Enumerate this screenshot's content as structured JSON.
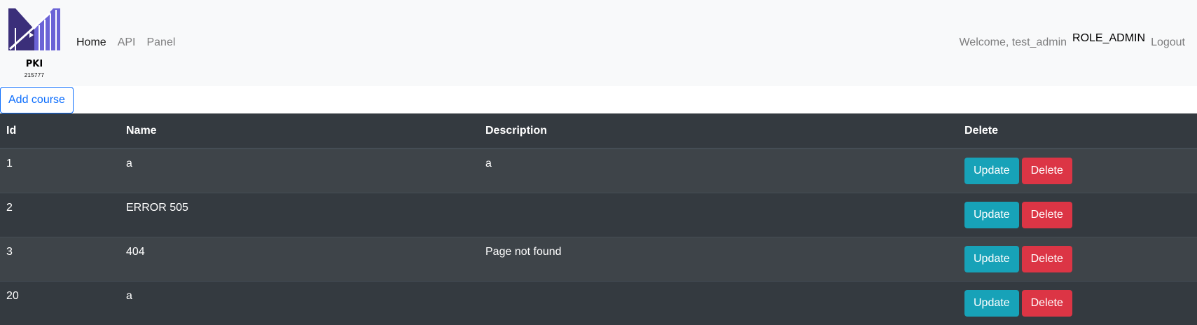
{
  "brand": {
    "title": "PKI",
    "subtitle": "215777",
    "colors": {
      "dark": "#3b2f7a",
      "light": "#6b63d6"
    }
  },
  "nav": {
    "items": [
      {
        "label": "Home",
        "active": true
      },
      {
        "label": "API",
        "active": false
      },
      {
        "label": "Panel",
        "active": false
      }
    ]
  },
  "user": {
    "welcome": "Welcome, test_admin",
    "role": "ROLE_ADMIN",
    "logout": "Logout"
  },
  "add_button": "Add course",
  "table": {
    "headers": {
      "id": "Id",
      "name": "Name",
      "description": "Description",
      "delete": "Delete"
    },
    "update_label": "Update",
    "delete_label": "Delete",
    "rows": [
      {
        "id": "1",
        "name": "a",
        "description": "a"
      },
      {
        "id": "2",
        "name": "ERROR 505",
        "description": ""
      },
      {
        "id": "3",
        "name": "404",
        "description": "Page not found"
      },
      {
        "id": "20",
        "name": "a",
        "description": ""
      }
    ]
  },
  "colors": {
    "update": "#17a2b8",
    "delete": "#dc3545",
    "table_bg": "#343a40",
    "primary": "#0d6efd"
  }
}
